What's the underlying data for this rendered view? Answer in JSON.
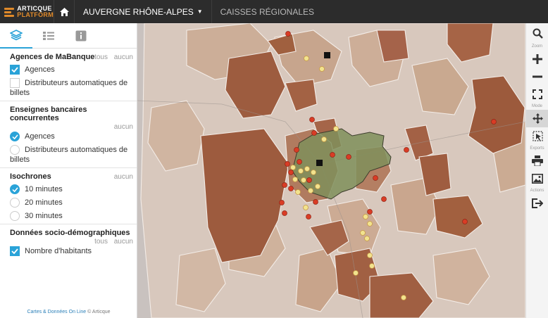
{
  "header": {
    "logo_top": "ARTICQUE",
    "logo_bottom": "PLATFORM",
    "region": "AUVERGNE RHÔNE-ALPES",
    "nav_link": "CAISSES RÉGIONALES"
  },
  "panel": {
    "links": {
      "all": "tous",
      "none": "aucun"
    },
    "sections": {
      "agencies": {
        "title": "Agences de MaBanque",
        "items": [
          "Agences",
          "Distributeurs automatiques de billets"
        ]
      },
      "competitors": {
        "title": "Enseignes bancaires concurrentes",
        "items": [
          "Agences",
          "Distributeurs automatiques de billets"
        ]
      },
      "isochrones": {
        "title": "Isochrones",
        "items": [
          "10 minutes",
          "20 minutes",
          "30 minutes"
        ]
      },
      "demographics": {
        "title": "Données socio-démographiques",
        "items": [
          "Nombre d'habitants"
        ]
      }
    },
    "footer": {
      "brand": "Cartes & Données On Line",
      "credit": "© Articque"
    }
  },
  "toolbar": {
    "zoom": "Zoom",
    "mode": "Mode",
    "exports": "Exports",
    "actions": "Actions"
  },
  "colors": {
    "accent": "#2aa3d8",
    "topbar": "#2c2c2c",
    "choropleth": [
      "#dccdc3",
      "#cdae98",
      "#b8876a",
      "#9a5b3f"
    ],
    "isochrone": "#7f8f5a",
    "agency_marker": "#f2e38e",
    "competitor_marker": "#d93c25"
  },
  "icons": {
    "home": "home-icon",
    "layers": "layers-icon",
    "legend": "list-icon",
    "info": "info-icon",
    "search": "search-icon",
    "zoom_in": "plus-icon",
    "zoom_out": "minus-icon",
    "fullscreen": "expand-icon",
    "pan": "move-icon",
    "select": "select-icon",
    "print": "print-icon",
    "image": "image-icon",
    "exit": "exit-icon"
  }
}
